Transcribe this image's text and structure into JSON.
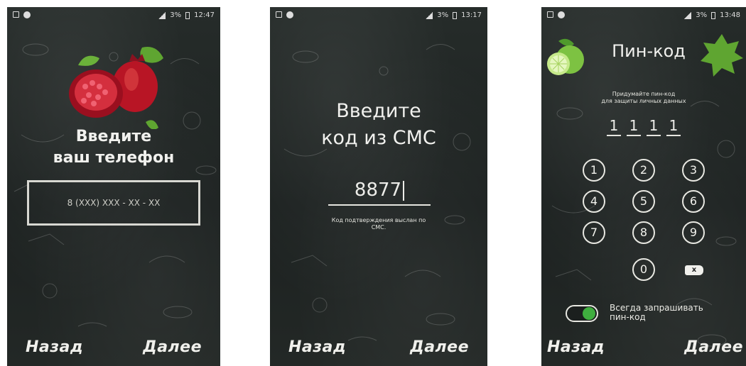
{
  "status_bar": {
    "screen1_time": "12:47",
    "screen2_time": "13:17",
    "screen3_time": "13:48",
    "battery": "3%"
  },
  "screen1": {
    "title_line1": "Введите",
    "title_line2": "ваш телефон",
    "phone_placeholder": "8 (XXX) XXX - XX - XX",
    "back": "Назад",
    "next": "Далее"
  },
  "screen2": {
    "title_line1": "Введите",
    "title_line2": "код из СМС",
    "code_value": "8877",
    "hint_line1": "Код подтверждения выслан по",
    "hint_line2": "СМС.",
    "back": "Назад",
    "next": "Далее"
  },
  "screen3": {
    "title": "Пин-код",
    "hint_line1": "Придумайте пин-код",
    "hint_line2": "для защиты личных данных",
    "pin_digits": [
      "1",
      "1",
      "1",
      "1"
    ],
    "keys": [
      "1",
      "2",
      "3",
      "4",
      "5",
      "6",
      "7",
      "8",
      "9",
      "0"
    ],
    "backspace_glyph": "x",
    "toggle_label_line1": "Всегда запрашивать",
    "toggle_label_line2": "пин-код",
    "toggle_on": true,
    "back": "Назад",
    "next": "Далее"
  },
  "colors": {
    "chalkboard": "#222826",
    "chalk_text": "#f0f0ec",
    "toggle_green": "#3fae3f",
    "leaf_green": "#5fa531",
    "pomegranate_red": "#c0182a"
  },
  "icons": {
    "fruit_screen1": "pomegranate-icon",
    "fruit_screen3": "lime-icon",
    "leaf": "grape-leaf-icon"
  }
}
